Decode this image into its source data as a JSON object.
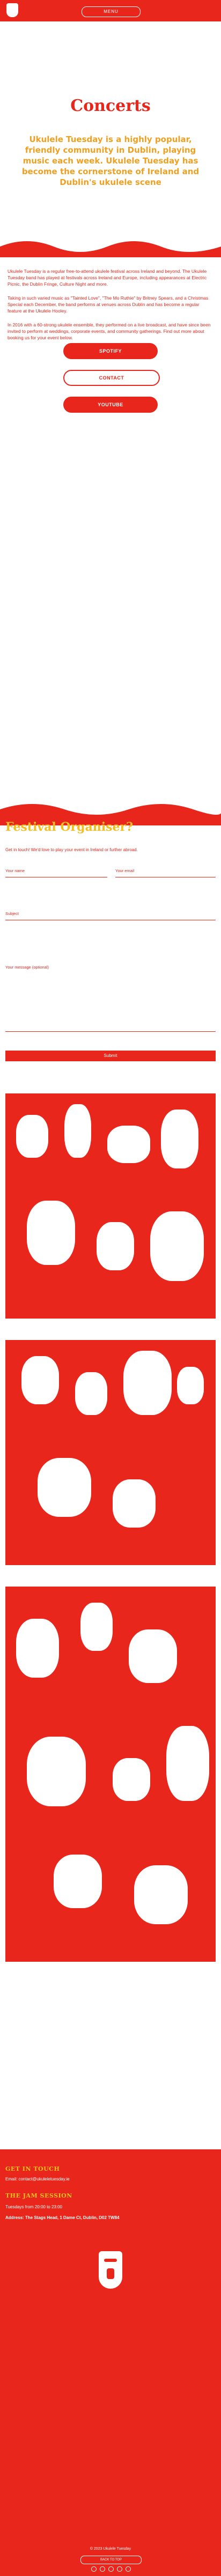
{
  "header": {
    "logo": "ukulele-head-icon",
    "nav_label": "MENU",
    "colors": {
      "primary": "#e8261c",
      "accent": "#f0c020",
      "secondary": "#f0a020"
    }
  },
  "hero": {
    "title": "Concerts",
    "intro": "Ukulele Tuesday is a highly popular, friendly community in Dublin, playing music each week. Ukulele Tuesday has become the cornerstone of Ireland and Dublin's ukulele scene"
  },
  "body": {
    "p1": "Ukulele Tuesday is a regular free-to-attend ukulele festival across Ireland and beyond. The Ukulele Tuesday band has played at festivals across Ireland and Europe, including appearances at Electric Picnic, the Dublin Fringe, Culture Night and more.",
    "p2": "Taking in such varied music as \"Tainted Love\", \"The Mo Ruthie\" by Britney Spears, and a Christmas Special each December, the band performs at venues across Dublin and has become a regular feature at the Ukulele Hooley.",
    "p3": "In 2016 with a 60-strong ukulele ensemble, they performed on a live broadcast, and have since been invited to perform at weddings, corporate events, and community gatherings. Find out more about booking us for your event below."
  },
  "buttons": {
    "spotify": "SPOTIFY",
    "contact": "CONTACT",
    "youtube": "YOUTUBE"
  },
  "form": {
    "title": "Festival Organiser?",
    "subtitle": "Get in touch! We'd love to play your event in Ireland or further abroad.",
    "name_label": "Your name",
    "email_label": "Your email",
    "subject_label": "Subject",
    "message_label": "Your message (optional)",
    "submit_label": "Submit"
  },
  "footer": {
    "heading_get_in_touch": "GET IN TOUCH",
    "email": "Email: contact@ukuleletuesday.ie",
    "heading_jam": "THE JAM SESSION",
    "schedule": "Tuesdays from 20:00 to 23:00",
    "address": "Address: The Stags Head, 1 Dame Ct, Dublin, D02 TW84",
    "copyright": "© 2023 Ukulele Tuesday",
    "back_to_top": "BACK TO TOP"
  }
}
